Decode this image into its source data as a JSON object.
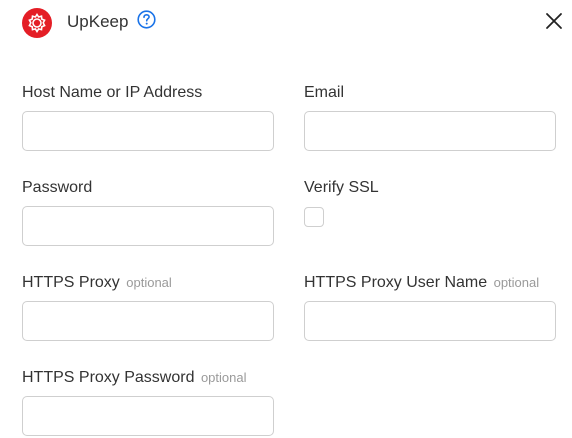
{
  "header": {
    "app_name": "UpKeep",
    "logo_icon": "gear-logo-icon",
    "help_icon": "help-circle-icon",
    "close_icon": "close-icon"
  },
  "colors": {
    "brand": "#e41e26",
    "help": "#1a73e8",
    "border": "#cfcfcf",
    "optional_text": "#9a9a9a"
  },
  "form": {
    "host": {
      "label": "Host Name or IP Address",
      "value": ""
    },
    "email": {
      "label": "Email",
      "value": ""
    },
    "password": {
      "label": "Password",
      "value": ""
    },
    "verify_ssl": {
      "label": "Verify SSL",
      "checked": false
    },
    "https_proxy": {
      "label": "HTTPS Proxy",
      "optional": "optional",
      "value": ""
    },
    "https_proxy_user": {
      "label": "HTTPS Proxy User Name",
      "optional": "optional",
      "value": ""
    },
    "https_proxy_password": {
      "label": "HTTPS Proxy Password",
      "optional": "optional",
      "value": ""
    }
  }
}
